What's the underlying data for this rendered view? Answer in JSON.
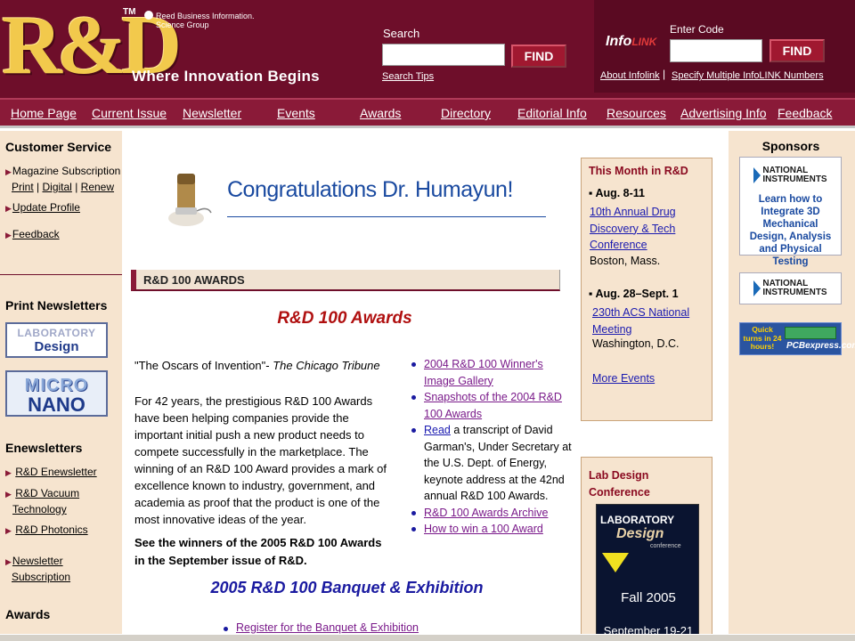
{
  "header": {
    "logo_text": "R&D",
    "trademark": "TM",
    "publisher_line1": "Reed Business Information.",
    "publisher_line2": "Science Group",
    "tagline": "Where Innovation Begins",
    "search_label": "Search",
    "search_value": "",
    "find_label": "FIND",
    "search_tips": "Search Tips",
    "infolink_logo_info": "Info",
    "infolink_logo_link": "LINK",
    "enter_code_label": "Enter Code",
    "code_value": "",
    "find_label_2": "FIND",
    "about_infolink": "About Infolink",
    "separator": "|",
    "specify_multiple": "Specify Multiple InfoLINK Numbers"
  },
  "nav": {
    "items": [
      {
        "label": "Home Page"
      },
      {
        "label": "Current Issue"
      },
      {
        "label": "Newsletter"
      },
      {
        "label": "Events"
      },
      {
        "label": "Awards"
      },
      {
        "label": "Directory"
      },
      {
        "label": "Editorial Info"
      },
      {
        "label": "Resources"
      },
      {
        "label": "Advertising Info"
      },
      {
        "label": "Feedback"
      }
    ]
  },
  "left_sidebar": {
    "customer_service_heading": "Customer Service",
    "magazine_subscription": "Magazine Subscription",
    "print": "Print",
    "digital": "Digital",
    "renew": "Renew",
    "pipe": "|",
    "update_profile": "Update Profile",
    "feedback": "Feedback",
    "print_newsletters_heading": "Print Newsletters",
    "lab_design_logo_top": "LABORATORY",
    "lab_design_logo_bottom": "Design",
    "micro_nano_top": "MICRO",
    "micro_nano_bottom": "NANO",
    "enewsletters_heading": "Enewsletters",
    "rd_enewsletter": "R&D Enewsletter",
    "rd_vacuum_1": "R&D Vacuum",
    "rd_vacuum_2": "Technology",
    "rd_photonics": "R&D Photonics",
    "newsletter_subscription_1": "Newsletter",
    "newsletter_subscription_2": "Subscription",
    "awards_heading": "Awards"
  },
  "main": {
    "congrats_title": "Congratulations Dr. Humayun!",
    "section_bar": "R&D 100 AWARDS",
    "awards_heading": "R&D 100 Awards",
    "quote_text": "\"The Oscars of Invention\"- ",
    "quote_source": "The Chicago Tribune",
    "description": "For 42 years, the prestigious R&D 100 Awards have been helping companies provide the important initial push a new product needs to compete successfully in the marketplace. The winning of an R&D 100 Award provides a mark of excellence known to industry, government, and academia as proof that the product is one of the most innovative ideas of the year.",
    "see_winners": "See the winners of the 2005 R&D 100 Awards in the September issue of R&D.",
    "links": {
      "gallery": "2004 R&D 100 Winner's Image Gallery",
      "snapshots": "Snapshots of the 2004 R&D 100 Awards",
      "read": "Read",
      "read_rest": " a transcript of David Garman's, Under Secretary at the U.S. Dept. of Energy, keynote address at the 42nd annual R&D 100 Awards.",
      "archive": "R&D 100 Awards Archive",
      "how_to_win": "How to win a 100 Award"
    },
    "banquet_heading": "2005 R&D 100 Banquet & Exhibition",
    "banquet_link": "Register for the Banquet & Exhibition"
  },
  "events": {
    "this_month_title": "This Month in R&D",
    "event1_date": "▪ Aug. 8-11",
    "event1_link": "10th Annual Drug Discovery & Tech Conference",
    "event1_place": "Boston, Mass.",
    "event2_date": "▪ Aug. 28–Sept. 1",
    "event2_link": "230th ACS National Meeting",
    "event2_place": "Washington, D.C.",
    "more_events": "More Events",
    "lab_conf_title": "Lab Design Conference",
    "ad_laboratory": "LABORATORY",
    "ad_design": "Design",
    "ad_conference": "conference",
    "ad_fall": "Fall 2005",
    "ad_dates": "September 19-21"
  },
  "sponsors": {
    "heading": "Sponsors",
    "ni_line1": "NATIONAL",
    "ni_line2": "INSTRUMENTS",
    "ni_tagline": "Learn how to Integrate 3D Mechanical Design, Analysis and Physical Testing",
    "pcb_quick": "Quick turns in 24 hours!",
    "pcb_name": "PCBexpress.com"
  },
  "colors": {
    "header_bg": "#6e0e2a",
    "nav_bg": "#8a1a38",
    "sidebar_bg": "#f6e4cf",
    "link_blue": "#1a1ab0",
    "link_visited": "#7a1a8a",
    "awards_red": "#b01010"
  }
}
